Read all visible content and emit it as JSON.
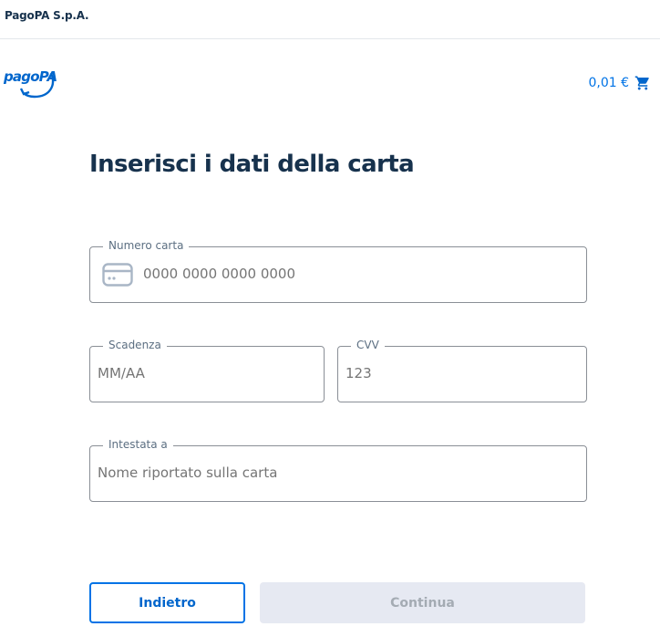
{
  "header": {
    "company": "PagoPA S.p.A."
  },
  "brand": {
    "logo_text": "pagoPA",
    "color": "#0066cc"
  },
  "cart": {
    "amount": "0,01 €",
    "icon": "cart-icon"
  },
  "page": {
    "title": "Inserisci i dati della carta"
  },
  "form": {
    "card_number": {
      "label": "Numero carta",
      "placeholder": "0000 0000 0000 0000",
      "icon": "credit-card-icon"
    },
    "expiry": {
      "label": "Scadenza",
      "placeholder": "MM/AA"
    },
    "cvv": {
      "label": "CVV",
      "placeholder": "123"
    },
    "holder": {
      "label": "Intestata a",
      "placeholder": "Nome riportato sulla carta"
    }
  },
  "actions": {
    "back": "Indietro",
    "continue": "Continua"
  },
  "colors": {
    "primary": "#0073e6",
    "text": "#17324d",
    "disabled_bg": "#e6e9f2",
    "disabled_text": "#a4abb3"
  }
}
